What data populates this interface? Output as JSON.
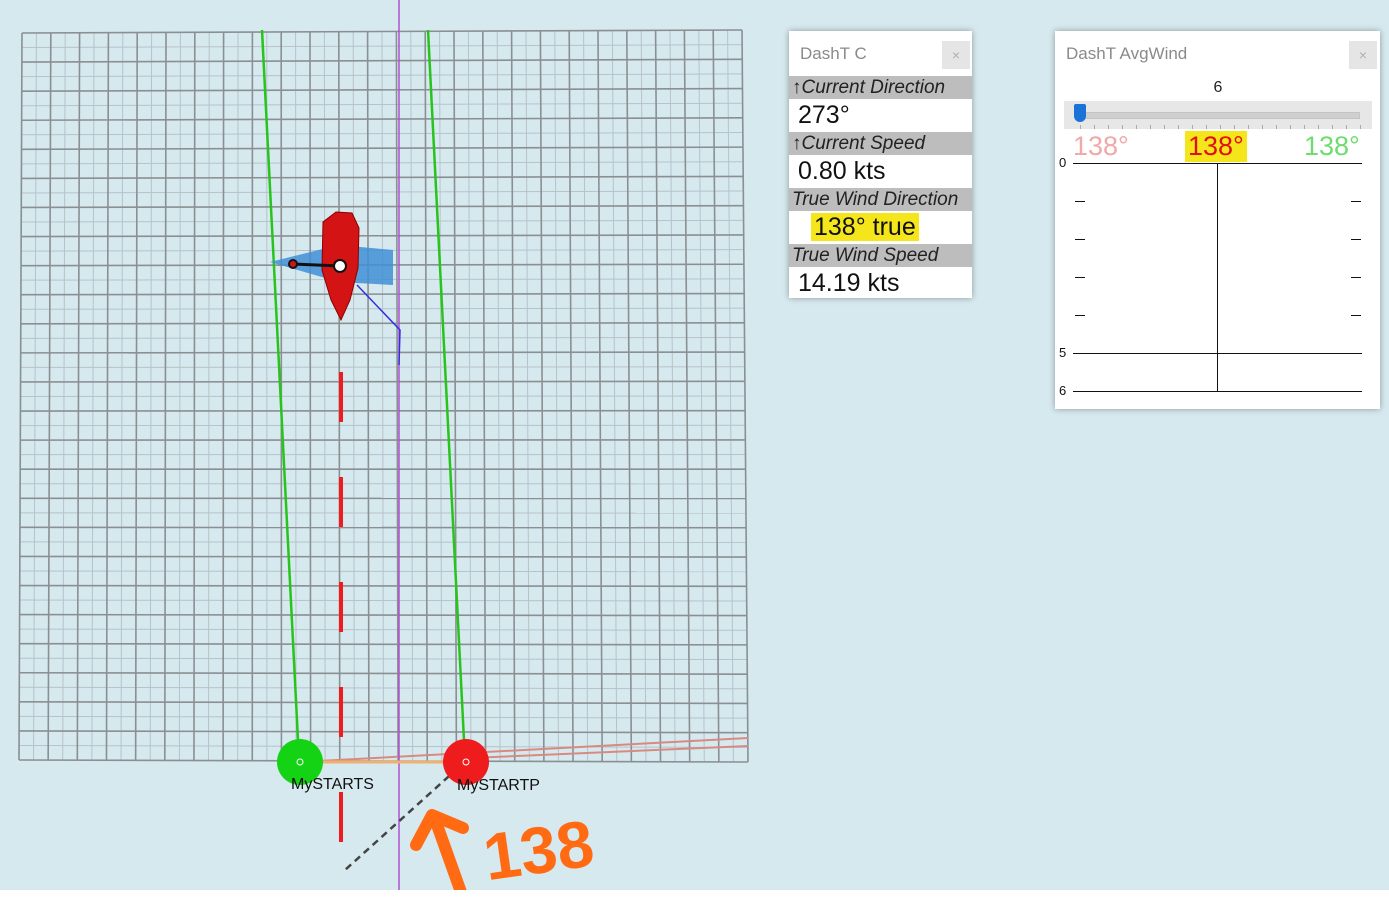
{
  "chart_view": {
    "marks": [
      {
        "name": "MySTARTS",
        "color": "#14d214"
      },
      {
        "name": "MySTARTP",
        "color": "#ee1c1c"
      }
    ],
    "annotation": "138",
    "annotation_color": "#ff6a13",
    "boat_color": "#d41414"
  },
  "dasht_c": {
    "title": "DashT C",
    "close_label": "×",
    "instruments": [
      {
        "label": "↑Current Direction",
        "value": "273°"
      },
      {
        "label": "↑Current Speed",
        "value": "0.80 kts"
      },
      {
        "label": "True Wind Direction",
        "value": "138° true"
      },
      {
        "label": "True Wind Speed",
        "value": "14.19 kts"
      }
    ]
  },
  "dasht_avgwind": {
    "title": "DashT AvgWind",
    "close_label": "×",
    "slider_value": "6",
    "dir_min": "138°",
    "dir_avg": "138°",
    "dir_max": "138°",
    "graph_labels": [
      "0",
      "5",
      "6"
    ]
  }
}
